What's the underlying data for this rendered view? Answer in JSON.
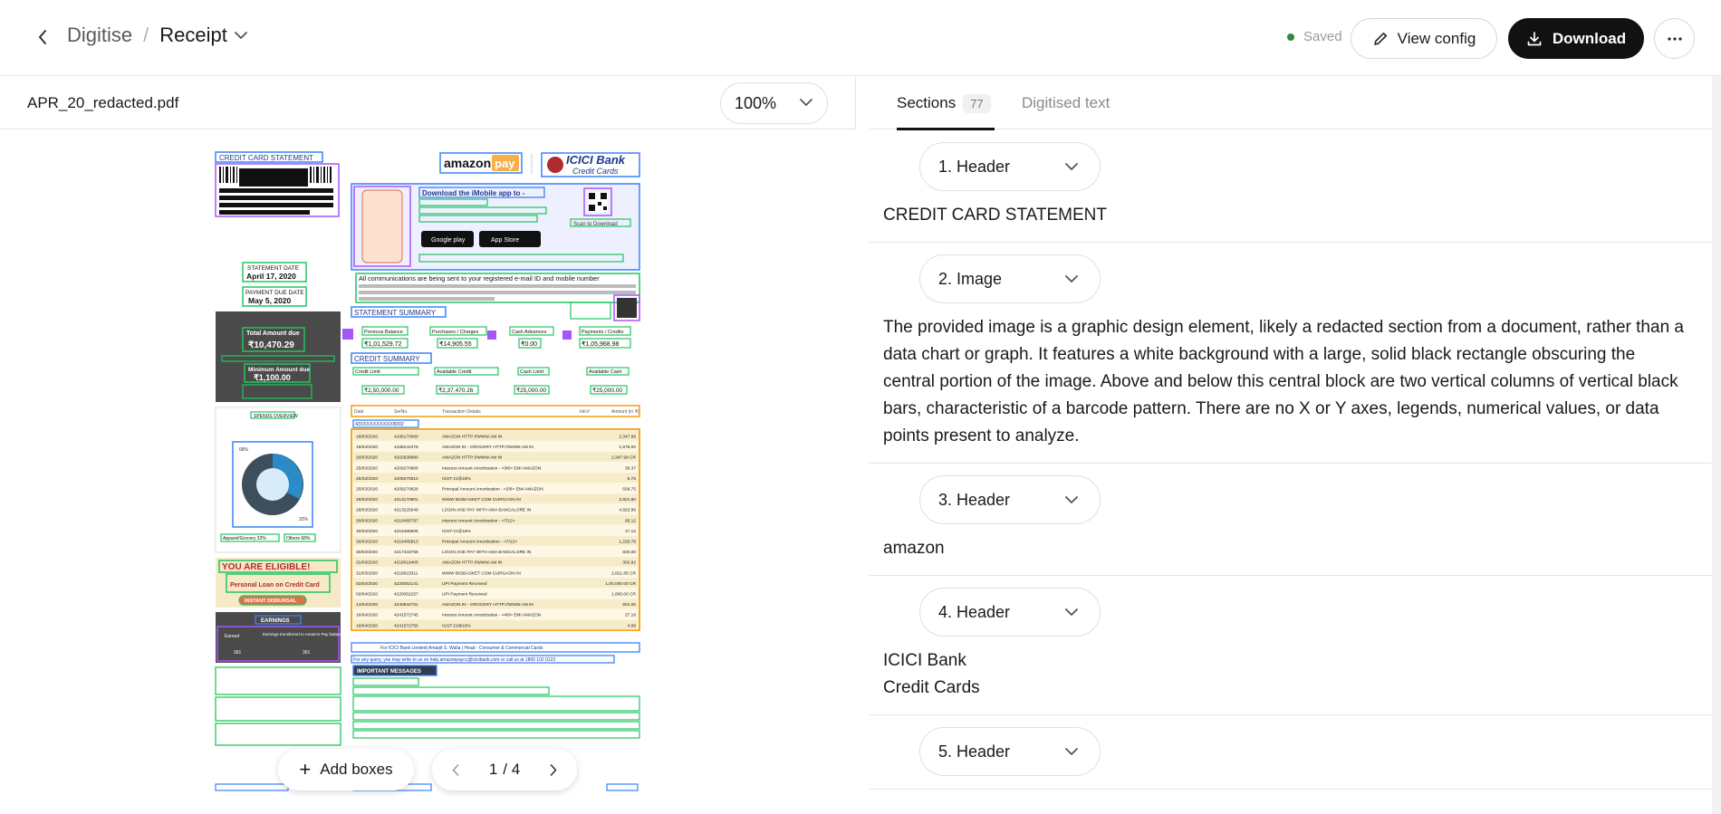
{
  "header": {
    "breadcrumb_parent": "Digitise",
    "breadcrumb_separator": "/",
    "breadcrumb_current": "Receipt",
    "saved_label": "Saved",
    "view_config_label": "View config",
    "download_label": "Download"
  },
  "viewer": {
    "filename": "APR_20_redacted.pdf",
    "zoom": "100%",
    "add_boxes_label": "Add boxes",
    "page_current": "1",
    "page_total": "/ 4"
  },
  "document": {
    "title": "CREDIT CARD STATEMENT",
    "amazon": "amazon",
    "pay": "pay",
    "bank": "ICICI Bank",
    "bank_sub": "Credit Cards",
    "download_app": "Download the iMobile app to -",
    "google_play": "Google play",
    "app_store": "App Store",
    "scan_download": "Scan to Download",
    "communication": "All communications are being sent to your registered e-mail ID and mobile number",
    "statement_date_label": "STATEMENT DATE",
    "statement_date": "April 17, 2020",
    "payment_due_label": "PAYMENT DUE DATE",
    "payment_due": "May 5, 2020",
    "statement_summary": "STATEMENT SUMMARY",
    "total_due_label": "Total Amount due",
    "total_due": "₹10,470.29",
    "min_due_label": "Minimum Amount due",
    "min_due": "₹1,100.00",
    "summary_headers": [
      "Previous Balance",
      "Purchases / Charges",
      "Cash Advances",
      "Payments / Credits"
    ],
    "summary_values": [
      "₹1,01,529.72",
      "₹14,905.55",
      "₹0.00",
      "₹1,05,968.98"
    ],
    "credit_summary": "CREDIT SUMMARY",
    "credit_headers": [
      "Credit Limit",
      "Available Credit",
      "Cash Limit",
      "Available Cash"
    ],
    "credit_values": [
      "₹2,50,000.00",
      "₹2,37,470.26",
      "₹25,000.00",
      "₹25,000.00"
    ],
    "txn_headers": [
      "Date",
      "SerNo.",
      "Transaction Details",
      "Intl.#",
      "Amount (in ₹)"
    ],
    "card_mask": "4315XXXXXXXX8002",
    "transactions": [
      [
        "18/03/2020",
        "4186170069",
        "AMAZON HTTP://WWW.AM IN",
        "2,347.99"
      ],
      [
        "19/03/2020",
        "4198242476",
        "AMAZON IN - GROCERY HTTP://WWW.AM IN",
        "1,678.00"
      ],
      [
        "20/03/2020",
        "4202638880",
        "AMAZON HTTP://WWW.AM IN",
        "2,347.99 CR"
      ],
      [
        "25/03/2020",
        "4209270806",
        "Interest Amount Amortization - <3/6> EMI AMAZON",
        "36.37"
      ],
      [
        "25/03/2020",
        "4209270812",
        "IGST-CI@18%",
        "6.75"
      ],
      [
        "25/03/2020",
        "4209270828",
        "Principal Amount Amortization - <3/6> EMI AMAZON",
        "509.75"
      ],
      [
        "26/03/2020",
        "4213170801",
        "WWW BIGBASKET COM GURGAON IN",
        "2,821.80"
      ],
      [
        "29/03/2020",
        "4213225649",
        "LOGIN AND PAY WITH AMA BANGALORE IN",
        "4,923.96"
      ],
      [
        "30/03/2020",
        "4216485797",
        "Interest Amount Amortization - <7/12>",
        "95.12"
      ],
      [
        "30/03/2020",
        "4216485805",
        "IGST-CI@18%",
        "17.12"
      ],
      [
        "30/03/2020",
        "4216485813",
        "Principal Amount Amortization - <7/12>",
        "1,229.76"
      ],
      [
        "30/03/2020",
        "4217433758",
        "LOGIN AND PAY WITH AMA BANGALORE IN",
        "830.80"
      ],
      [
        "31/03/2020",
        "4218019406",
        "AMAZON HTTP://WWW.AM IN",
        "302.82"
      ],
      [
        "31/03/2020",
        "4218623311",
        "WWW BIGBASKET COM GURGAON IN",
        "2,821.85 CR"
      ],
      [
        "02/04/2020",
        "4220052141",
        "UPI Payment Received",
        "1,00,000.00 CR"
      ],
      [
        "02/04/2020",
        "4220052257",
        "UPI Payment Received",
        "1,600.00 CR"
      ],
      [
        "14/04/2020",
        "4240844761",
        "AMAZON IN - GROCERY HTTP://WWW.AM IN",
        "601.00"
      ],
      [
        "16/04/2020",
        "4241572745",
        "Interest Amount Amortization - <4/6> EMI AMAZON",
        "27.18"
      ],
      [
        "16/04/2020",
        "4241572750",
        "IGST-CI@18%",
        "4.89"
      ]
    ],
    "spends_label": "SPENDS OVERVIEW",
    "donut_pct_a": "68%",
    "donut_pct_b": "32%",
    "legend_a": "Apparel/Grocery 32%",
    "legend_b": "Others 68%",
    "eligible": "YOU ARE ELIGIBLE!",
    "personal_loan": "Personal Loan on Credit Card",
    "instant": "INSTANT DISBURSAL",
    "earnings": "EARNINGS",
    "earnings_headers": [
      "Earned",
      "Earnings transferred to Amazon Pay balance*"
    ],
    "earnings_values": [
      "361",
      "361"
    ],
    "icici_limited": "For ICICI Bank Limited| Amarjit S. Walia | Head - Consumer & Commercial Cards",
    "query_line": "For any query, you may write to us on help.amazonpaycc@icicibank.com or call us at 1800 102 0123",
    "important": "IMPORTANT MESSAGES"
  },
  "tabs": {
    "sections_label": "Sections",
    "sections_count": "77",
    "digitised_label": "Digitised text"
  },
  "sections": [
    {
      "label": "1. Header",
      "lines": [
        "CREDIT CARD STATEMENT"
      ]
    },
    {
      "label": "2. Image",
      "lines": [
        "The provided image is a graphic design element, likely a redacted section from a document, rather than a data chart or graph. It features a white background with a large, solid black rectangle obscuring the central portion of the image. Above and below this central block are two vertical columns of vertical black bars, characteristic of a barcode pattern. There are no X or Y axes, legends, numerical values, or data points present to analyze."
      ]
    },
    {
      "label": "3. Header",
      "lines": [
        "amazon"
      ]
    },
    {
      "label": "4. Header",
      "lines": [
        "ICICI Bank",
        "Credit Cards"
      ]
    },
    {
      "label": "5. Header",
      "lines": []
    }
  ],
  "colors": {
    "box_blue": "#3b82f6",
    "box_green": "#22c55e",
    "box_purple": "#a855f7",
    "box_orange": "#f59e0b",
    "saved_dot": "#2e8b3d",
    "download_bg": "#111111"
  }
}
